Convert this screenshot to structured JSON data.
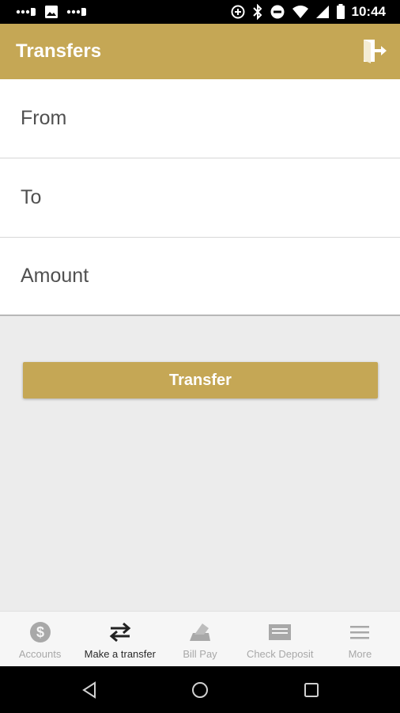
{
  "status_bar": {
    "time": "10:44",
    "left_icons": [
      "signal-dots-icon",
      "image-icon",
      "signal-dots-icon"
    ],
    "right_icons": [
      "data-saver-icon",
      "bluetooth-icon",
      "do-not-disturb-icon",
      "wifi-icon",
      "cell-signal-icon",
      "battery-icon"
    ]
  },
  "app_bar": {
    "title": "Transfers",
    "action_icon": "exit-door-icon"
  },
  "form": {
    "fields": [
      {
        "label": "From"
      },
      {
        "label": "To"
      },
      {
        "label": "Amount"
      }
    ]
  },
  "actions": {
    "transfer_label": "Transfer"
  },
  "tabs": [
    {
      "label": "Accounts",
      "icon": "dollar-icon",
      "active": false
    },
    {
      "label": "Make a transfer",
      "icon": "transfer-arrows-icon",
      "active": true
    },
    {
      "label": "Bill Pay",
      "icon": "bill-pay-icon",
      "active": false
    },
    {
      "label": "Check Deposit",
      "icon": "check-icon",
      "active": false
    },
    {
      "label": "More",
      "icon": "menu-icon",
      "active": false
    }
  ],
  "colors": {
    "accent": "#c5a755",
    "background": "#ececec",
    "active_tab": "#2a2a2a",
    "inactive_tab": "#a8a8a8"
  }
}
